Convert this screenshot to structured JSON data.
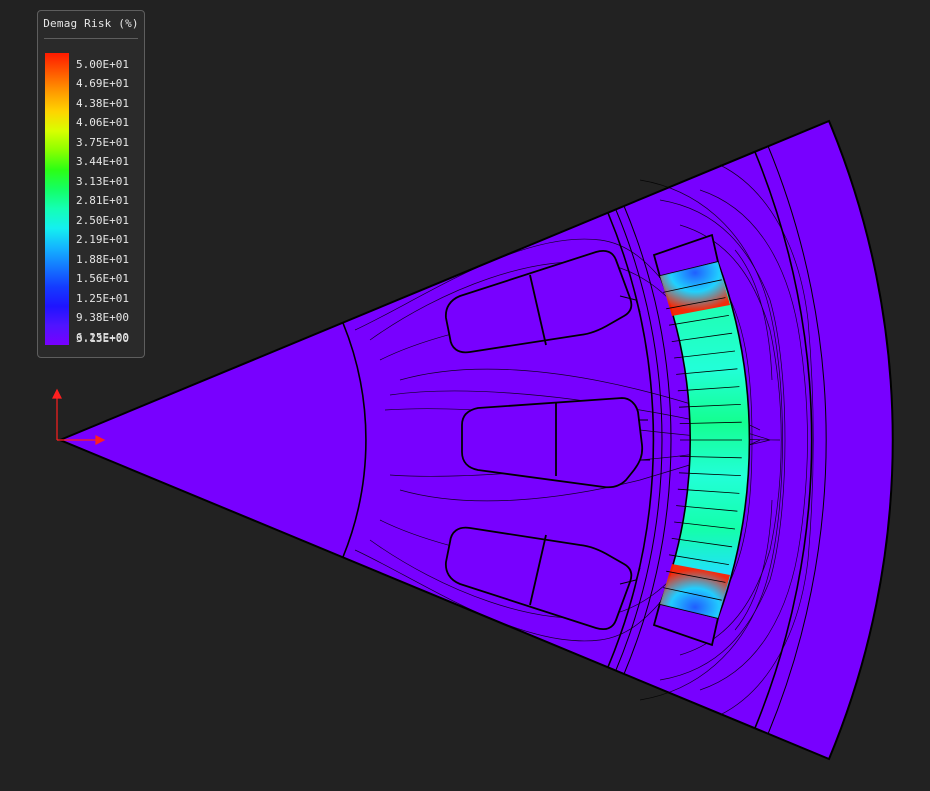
{
  "legend": {
    "title": "Demag Risk (%)",
    "labels": [
      "5.00E+01",
      "4.69E+01",
      "4.38E+01",
      "4.06E+01",
      "3.75E+01",
      "3.44E+01",
      "3.13E+01",
      "2.81E+01",
      "2.50E+01",
      "2.19E+01",
      "1.88E+01",
      "1.56E+01",
      "1.25E+01",
      "9.38E+00",
      "6.25E+00",
      "3.13E+00"
    ],
    "colormap": [
      "#ff1a00",
      "#ff5a00",
      "#ff9a00",
      "#ffd400",
      "#d8ff00",
      "#8cff00",
      "#2cff14",
      "#14ff64",
      "#14ffb4",
      "#14f0f0",
      "#14b4ff",
      "#1478ff",
      "#143cff",
      "#1e14ff",
      "#5014ff",
      "#7800ff"
    ]
  },
  "model": {
    "background_color": "#7800ff",
    "line_color": "#000000",
    "axis_color": "#ff2020"
  }
}
